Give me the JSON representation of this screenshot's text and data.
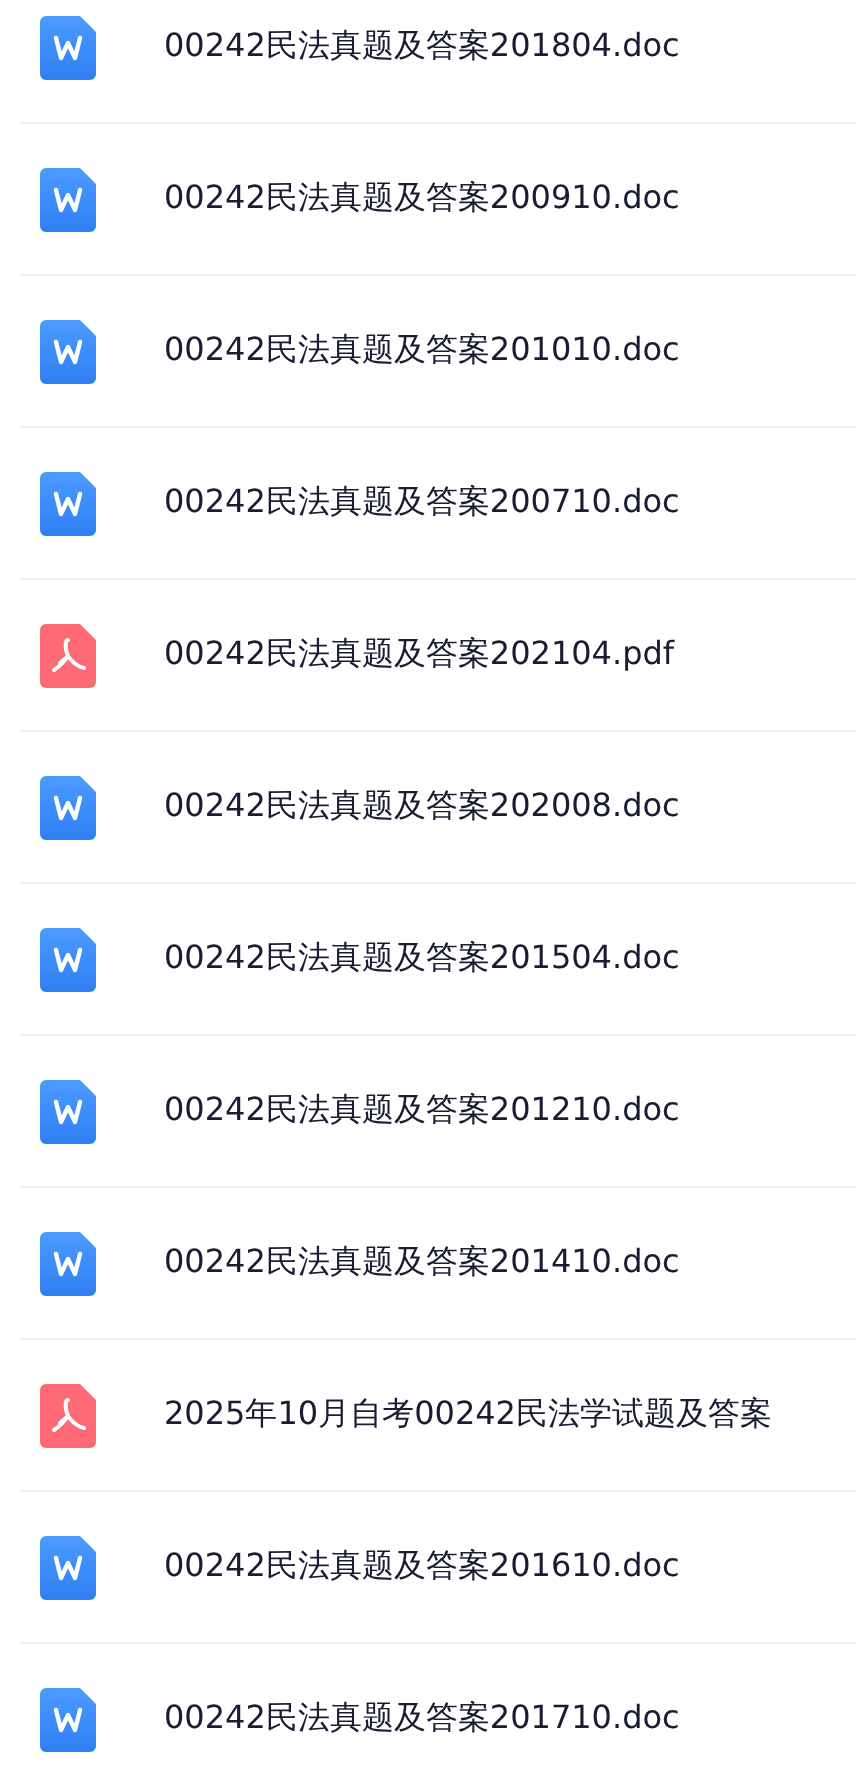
{
  "files": [
    {
      "kind": "doc",
      "name": "00242民法真题及答案201804.doc"
    },
    {
      "kind": "doc",
      "name": "00242民法真题及答案200910.doc"
    },
    {
      "kind": "doc",
      "name": "00242民法真题及答案201010.doc"
    },
    {
      "kind": "doc",
      "name": "00242民法真题及答案200710.doc"
    },
    {
      "kind": "pdf",
      "name": "00242民法真题及答案202104.pdf"
    },
    {
      "kind": "doc",
      "name": "00242民法真题及答案202008.doc"
    },
    {
      "kind": "doc",
      "name": "00242民法真题及答案201504.doc"
    },
    {
      "kind": "doc",
      "name": "00242民法真题及答案201210.doc"
    },
    {
      "kind": "doc",
      "name": "00242民法真题及答案201410.doc"
    },
    {
      "kind": "pdf",
      "name": "2025年10月自考00242民法学试题及答案"
    },
    {
      "kind": "doc",
      "name": "00242民法真题及答案201610.doc"
    },
    {
      "kind": "doc",
      "name": "00242民法真题及答案201710.doc"
    }
  ]
}
